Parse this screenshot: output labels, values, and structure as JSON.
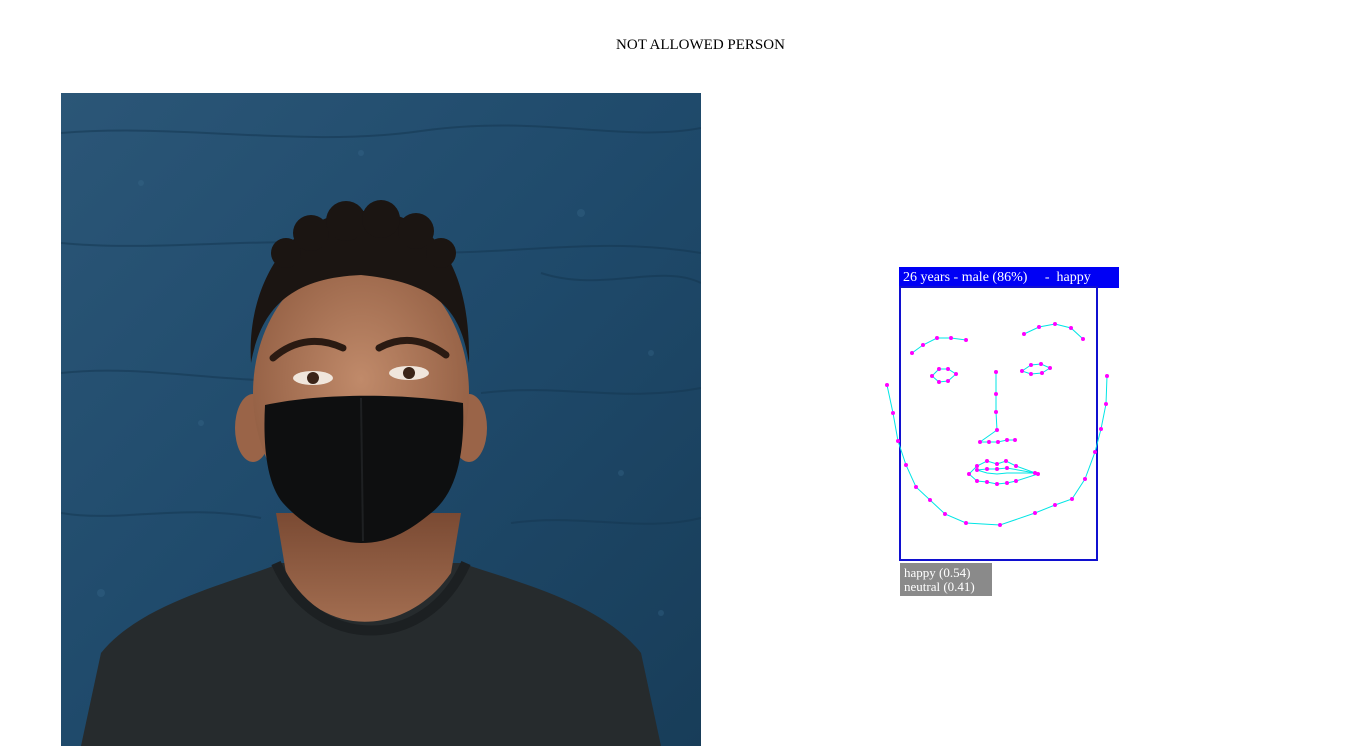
{
  "page": {
    "headline": "NOT ALLOWED PERSON"
  },
  "photo": {
    "subject": "person wearing black face mask in front of blue textured wall"
  },
  "detection": {
    "label": "26 years - male (86%)     -  happy",
    "box_color": "#1010d0",
    "label_bg": "#0000f5",
    "landmark_point_color": "#ff00ff",
    "landmark_line_color": "#00e5e5"
  },
  "emotions": {
    "items": [
      {
        "text": "happy (0.54)"
      },
      {
        "text": "neutral (0.41)"
      }
    ],
    "bg": "#8a8a8a"
  }
}
